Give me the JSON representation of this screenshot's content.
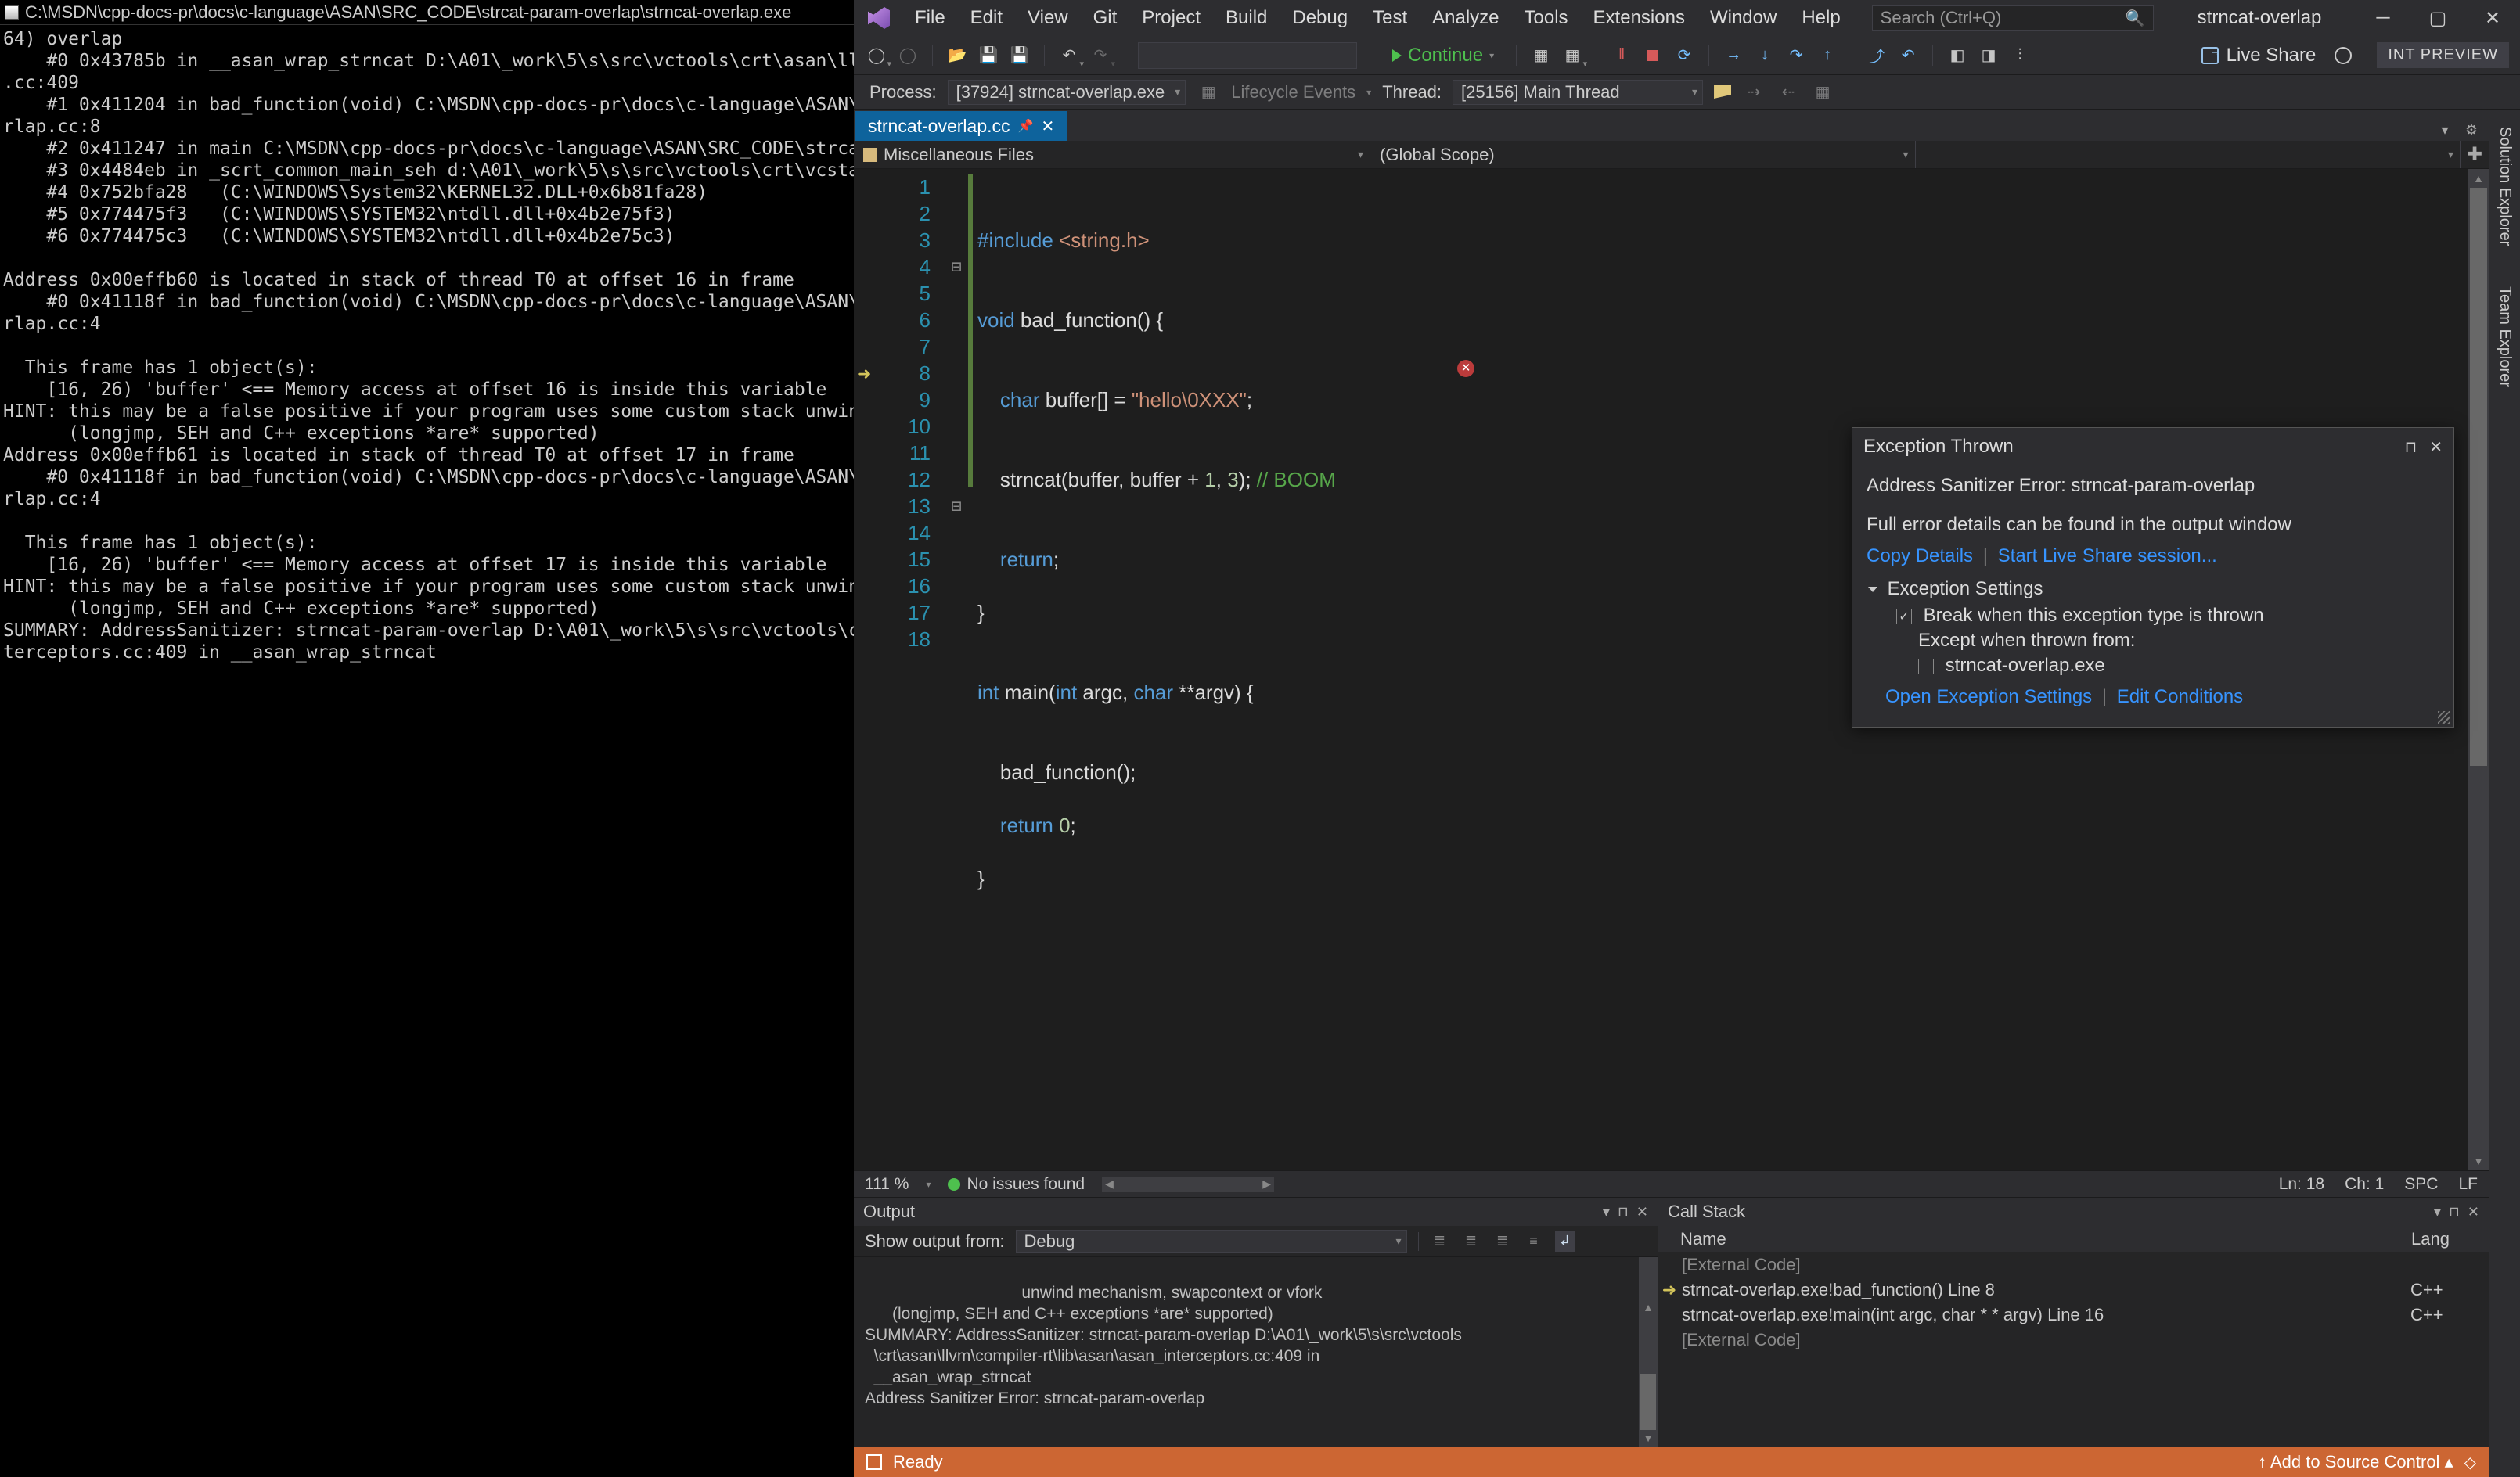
{
  "console": {
    "title": "C:\\MSDN\\cpp-docs-pr\\docs\\c-language\\ASAN\\SRC_CODE\\strcat-param-overlap\\strncat-overlap.exe",
    "body": "64) overlap\n    #0 0x43785b in __asan_wrap_strncat D:\\A01\\_work\\5\\s\\src\\vctools\\crt\\asan\\llvm\\co\n.cc:409\n    #1 0x411204 in bad_function(void) C:\\MSDN\\cpp-docs-pr\\docs\\c-language\\ASAN\\SRC_C\nrlap.cc:8\n    #2 0x411247 in main C:\\MSDN\\cpp-docs-pr\\docs\\c-language\\ASAN\\SRC_CODE\\strcat-par\n    #3 0x4484eb in _scrt_common_main_seh d:\\A01\\_work\\5\\s\\src\\vctools\\crt\\vcstartup\\\n    #4 0x752bfa28   (C:\\WINDOWS\\System32\\KERNEL32.DLL+0x6b81fa28)\n    #5 0x774475f3   (C:\\WINDOWS\\SYSTEM32\\ntdll.dll+0x4b2e75f3)\n    #6 0x774475c3   (C:\\WINDOWS\\SYSTEM32\\ntdll.dll+0x4b2e75c3)\n\nAddress 0x00effb60 is located in stack of thread T0 at offset 16 in frame\n    #0 0x41118f in bad_function(void) C:\\MSDN\\cpp-docs-pr\\docs\\c-language\\ASAN\\SRC_C\nrlap.cc:4\n\n  This frame has 1 object(s):\n    [16, 26) 'buffer' <== Memory access at offset 16 is inside this variable\nHINT: this may be a false positive if your program uses some custom stack unwind mec\n      (longjmp, SEH and C++ exceptions *are* supported)\nAddress 0x00effb61 is located in stack of thread T0 at offset 17 in frame\n    #0 0x41118f in bad_function(void) C:\\MSDN\\cpp-docs-pr\\docs\\c-language\\ASAN\\SRC_C\nrlap.cc:4\n\n  This frame has 1 object(s):\n    [16, 26) 'buffer' <== Memory access at offset 17 is inside this variable\nHINT: this may be a false positive if your program uses some custom stack unwind mec\n      (longjmp, SEH and C++ exceptions *are* supported)\nSUMMARY: AddressSanitizer: strncat-param-overlap D:\\A01\\_work\\5\\s\\src\\vctools\\crt\\as\nterceptors.cc:409 in __asan_wrap_strncat"
  },
  "vs": {
    "menus": [
      "File",
      "Edit",
      "View",
      "Git",
      "Project",
      "Build",
      "Debug",
      "Test",
      "Analyze",
      "Tools",
      "Extensions",
      "Window",
      "Help"
    ],
    "search_placeholder": "Search (Ctrl+Q)",
    "solution_name": "strncat-overlap",
    "toolbar": {
      "continue": "Continue",
      "live_share": "Live Share",
      "int_preview": "INT PREVIEW"
    },
    "toolbar2": {
      "process_label": "Process:",
      "process_value": "[37924] strncat-overlap.exe",
      "lifecycle": "Lifecycle Events",
      "thread_label": "Thread:",
      "thread_value": "[25156] Main Thread"
    },
    "tab": {
      "name": "strncat-overlap.cc"
    },
    "nav": {
      "scope1": "Miscellaneous Files",
      "scope2": "(Global Scope)"
    },
    "right_rail": [
      "Solution Explorer",
      "Team Explorer"
    ],
    "code_lines": [
      "",
      "#include <string.h>",
      "",
      "void bad_function() {",
      "",
      "    char buffer[] = \"hello\\0XXX\";",
      "",
      "    strncat(buffer, buffer + 1, 3); // BOOM",
      "",
      "    return;",
      "}",
      "",
      "int main(int argc, char **argv) {",
      "",
      "    bad_function();",
      "    return 0;",
      "}",
      ""
    ],
    "exception": {
      "title": "Exception Thrown",
      "message": "Address Sanitizer Error: strncat-param-overlap",
      "detail": "Full error details can be found in the output window",
      "copy": "Copy Details",
      "start_ls": "Start Live Share session...",
      "settings_hdr": "Exception Settings",
      "break_when": "Break when this exception type is thrown",
      "except_from": "Except when thrown from:",
      "except_item": "strncat-overlap.exe",
      "open_settings": "Open Exception Settings",
      "edit_cond": "Edit Conditions"
    },
    "editor_status": {
      "zoom": "111 %",
      "issues": "No issues found",
      "ln": "Ln: 18",
      "ch": "Ch: 1",
      "spc": "SPC",
      "lf": "LF"
    },
    "output": {
      "title": "Output",
      "from_label": "Show output from:",
      "from_value": "Debug",
      "body": "    unwind mechanism, swapcontext or vfork\n      (longjmp, SEH and C++ exceptions *are* supported)\nSUMMARY: AddressSanitizer: strncat-param-overlap D:\\A01\\_work\\5\\s\\src\\vctools\n  \\crt\\asan\\llvm\\compiler-rt\\lib\\asan\\asan_interceptors.cc:409 in\n  __asan_wrap_strncat\nAddress Sanitizer Error: strncat-param-overlap"
    },
    "callstack": {
      "title": "Call Stack",
      "col_name": "Name",
      "col_lang": "Lang",
      "rows": [
        {
          "ic": "",
          "txt": "[External Code]",
          "lang": "",
          "dim": true
        },
        {
          "ic": "➜",
          "txt": "strncat-overlap.exe!bad_function() Line 8",
          "lang": "C++",
          "dim": false
        },
        {
          "ic": "",
          "txt": "strncat-overlap.exe!main(int argc, char * * argv) Line 16",
          "lang": "C++",
          "dim": false
        },
        {
          "ic": "",
          "txt": "[External Code]",
          "lang": "",
          "dim": true
        }
      ]
    },
    "statusbar": {
      "ready": "Ready",
      "src_ctrl": "Add to Source Control"
    }
  }
}
